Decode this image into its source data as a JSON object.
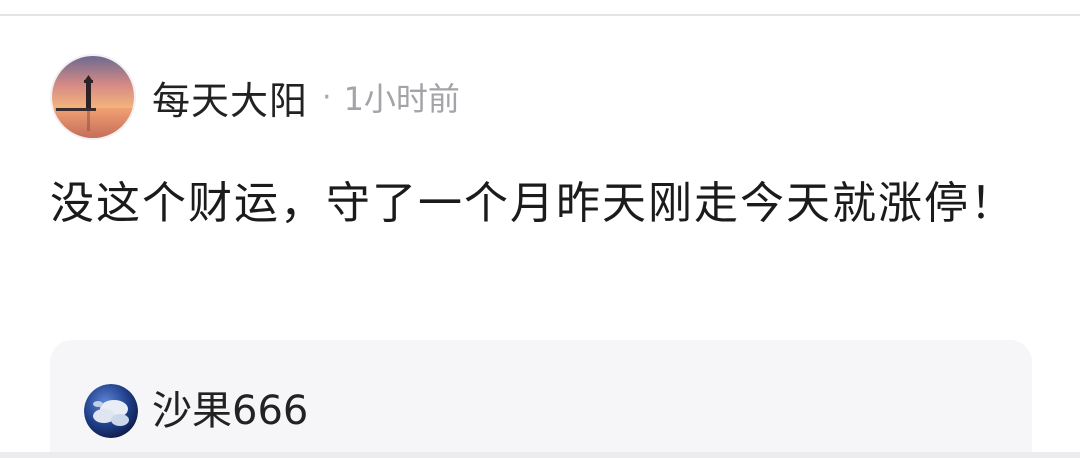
{
  "post": {
    "author": {
      "name": "每天大阳",
      "avatar_icon": "lighthouse-sunset-avatar"
    },
    "separator": "·",
    "time": "1小时前",
    "content": "没这个财运，守了一个月昨天刚走今天就涨停！"
  },
  "quote": {
    "author": {
      "name": "沙果666",
      "avatar_icon": "planet-cloud-avatar"
    }
  },
  "colors": {
    "text_primary": "#1b1b1b",
    "text_secondary": "#a3a3a8",
    "card_background": "#f6f6f8",
    "divider": "#e4e4e6"
  }
}
